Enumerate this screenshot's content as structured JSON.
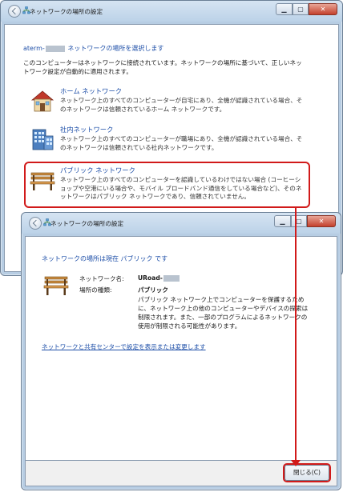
{
  "window1": {
    "title": "ネットワークの場所の設定",
    "heading_prefix": "aterm-",
    "heading_suffix": " ネットワークの場所を選択します",
    "intro": "このコンピューターはネットワークに接続されています。ネットワークの場所に基づいて、正しいネットワーク設定が自動的に適用されます。",
    "options": [
      {
        "title": "ホーム ネットワーク",
        "icon": "house-icon",
        "description": "ネットワーク上のすべてのコンピューターが自宅にあり、全機が認識されている場合、そのネットワークは信頼されているホーム ネットワークです。"
      },
      {
        "title": "社内ネットワーク",
        "icon": "office-building-icon",
        "description": "ネットワーク上のすべてのコンピューターが職場にあり、全機が認識されている場合、そのネットワークは信頼されている社内ネットワークです。"
      },
      {
        "title": "パブリック ネットワーク",
        "icon": "park-bench-icon",
        "description": "ネットワーク上のすべてのコンピューターを認識しているわけではない場合 (コーヒーショップや空港にいる場合や、モバイル ブロードバンド通信をしている場合など)、そのネットワークはパブリック ネットワークであり、信頼されていません。"
      }
    ]
  },
  "window2": {
    "title": "ネットワークの場所の設定",
    "status_line": "ネットワークの場所は現在 パブリック です",
    "network_name_label": "ネットワーク名:",
    "network_name_value": "URoad-",
    "location_type_label": "場所の種類:",
    "location_type_value": "パブリック",
    "location_description": "パブリック ネットワーク上でコンピューターを保護するために、ネットワーク上の他のコンピューターやデバイスの探索は制限されます。また、一部のプログラムによるネットワークの使用が制限される可能性があります。",
    "share_center_link": "ネットワークと共有センターで設定を表示または変更します",
    "close_button": "閉じる(C)"
  },
  "colors": {
    "link": "#1e4fa8",
    "annotation": "#d11a1a",
    "frame": "#b7cde3"
  }
}
